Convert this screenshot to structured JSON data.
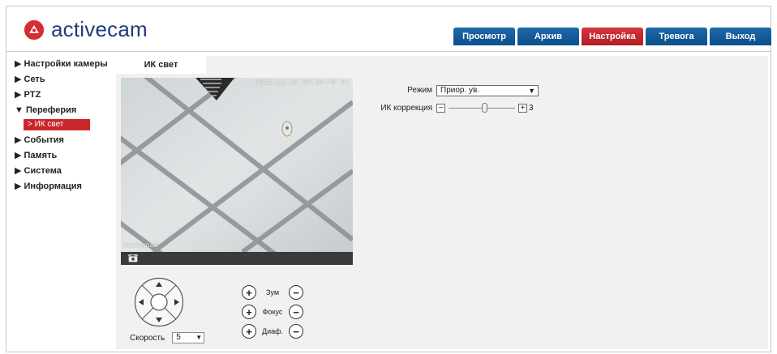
{
  "brand": {
    "name": "activecam",
    "accent": "#d72c32",
    "text_color": "#1f3d7a",
    "logo_icon": "activecam-logo-icon"
  },
  "top_tabs": [
    {
      "label": "Просмотр",
      "active": false
    },
    {
      "label": "Архив",
      "active": false
    },
    {
      "label": "Настройка",
      "active": true
    },
    {
      "label": "Тревога",
      "active": false
    },
    {
      "label": "Выход",
      "active": false
    }
  ],
  "colors": {
    "tab_blue": "#0f589a",
    "tab_active_red": "#c9262c",
    "content_bg": "#f1f1f1"
  },
  "sidebar": {
    "items": [
      {
        "label": "▶ Настройки камеры"
      },
      {
        "label": "▶ Сеть"
      },
      {
        "label": "▶ PTZ"
      },
      {
        "label": "▼ Переферия"
      },
      {
        "label": "▶ События"
      },
      {
        "label": "▶ Память"
      },
      {
        "label": "▶ Система"
      },
      {
        "label": "▶ Информация"
      }
    ],
    "active_sub": {
      "label": "> ИК свет"
    }
  },
  "content": {
    "tab_label": "ИК свет",
    "video": {
      "timestamp": "2019-12-19 20:34:40 Вт",
      "channel_name": "Activecam",
      "snapshot_icon": "camera-icon"
    },
    "ptz": {
      "speed_label": "Скорость",
      "speed_value": "5"
    },
    "lens": {
      "zoom_label": "Зум",
      "focus_label": "Фокус",
      "iris_label": "Диаф.",
      "plus": "+",
      "minus": "−"
    },
    "settings": {
      "mode_label": "Режим",
      "mode_value": "Приор. ув.",
      "ir_label": "ИК коррекция",
      "ir_value": "3",
      "ir_level_fraction": 0.55,
      "minus": "−",
      "plus": "+"
    }
  }
}
